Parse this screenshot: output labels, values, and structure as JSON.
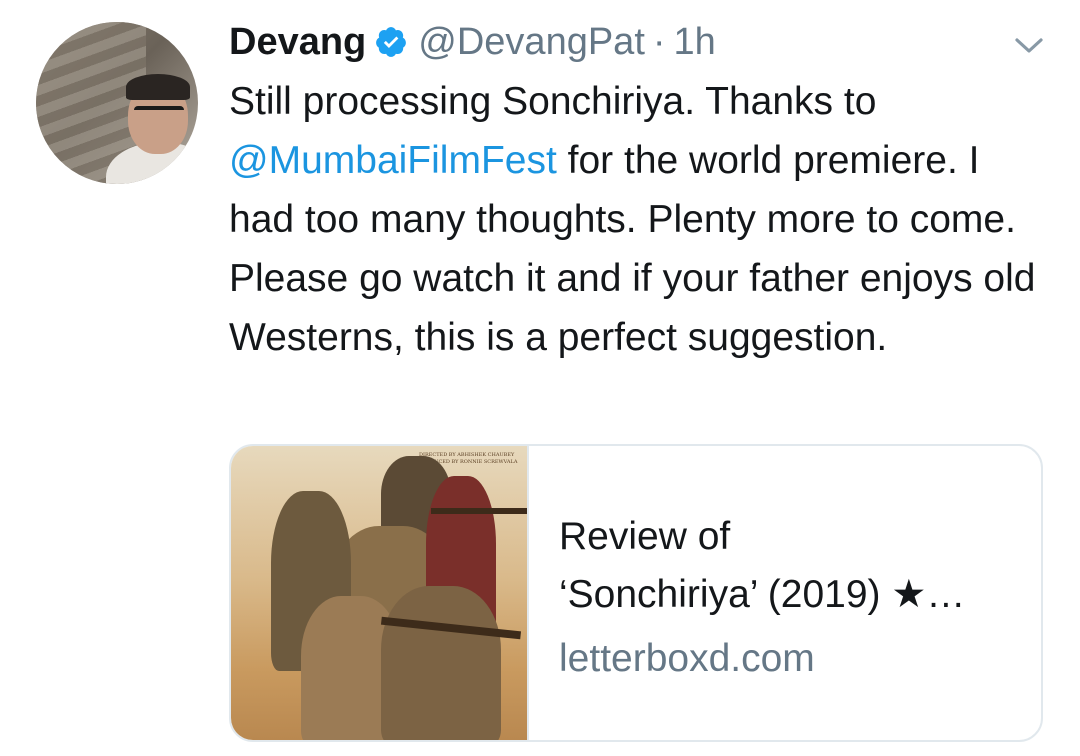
{
  "author": {
    "name": "Devang",
    "handle": "@DevangPat",
    "separator": "·",
    "time": "1h",
    "verified_icon": "verified-badge-icon",
    "avatar_icon": "avatar"
  },
  "tweet": {
    "text_before_mention": "Still processing Sonchiriya. Thanks to ",
    "mention": "@MumbaiFilmFest",
    "text_after_mention": " for the world premiere. I had too many thoughts. Plenty more to come. Please go watch it and if your father enjoys old Westerns, this is a perfect suggestion."
  },
  "card": {
    "title": "Review of\n‘Sonchiriya’ (2019) ★…",
    "domain": "letterboxd.com",
    "poster_credit_line1": "DIRECTED BY ABHISHEK CHAUBEY",
    "poster_credit_line2": "PRODUCED BY RONNIE SCREWVALA"
  },
  "colors": {
    "link": "#1b95e0",
    "secondary": "#657786",
    "primary_text": "#14171a",
    "border": "#e1e8ed"
  },
  "icons": {
    "caret": "chevron-down-icon",
    "verified": "verified-badge-icon"
  }
}
